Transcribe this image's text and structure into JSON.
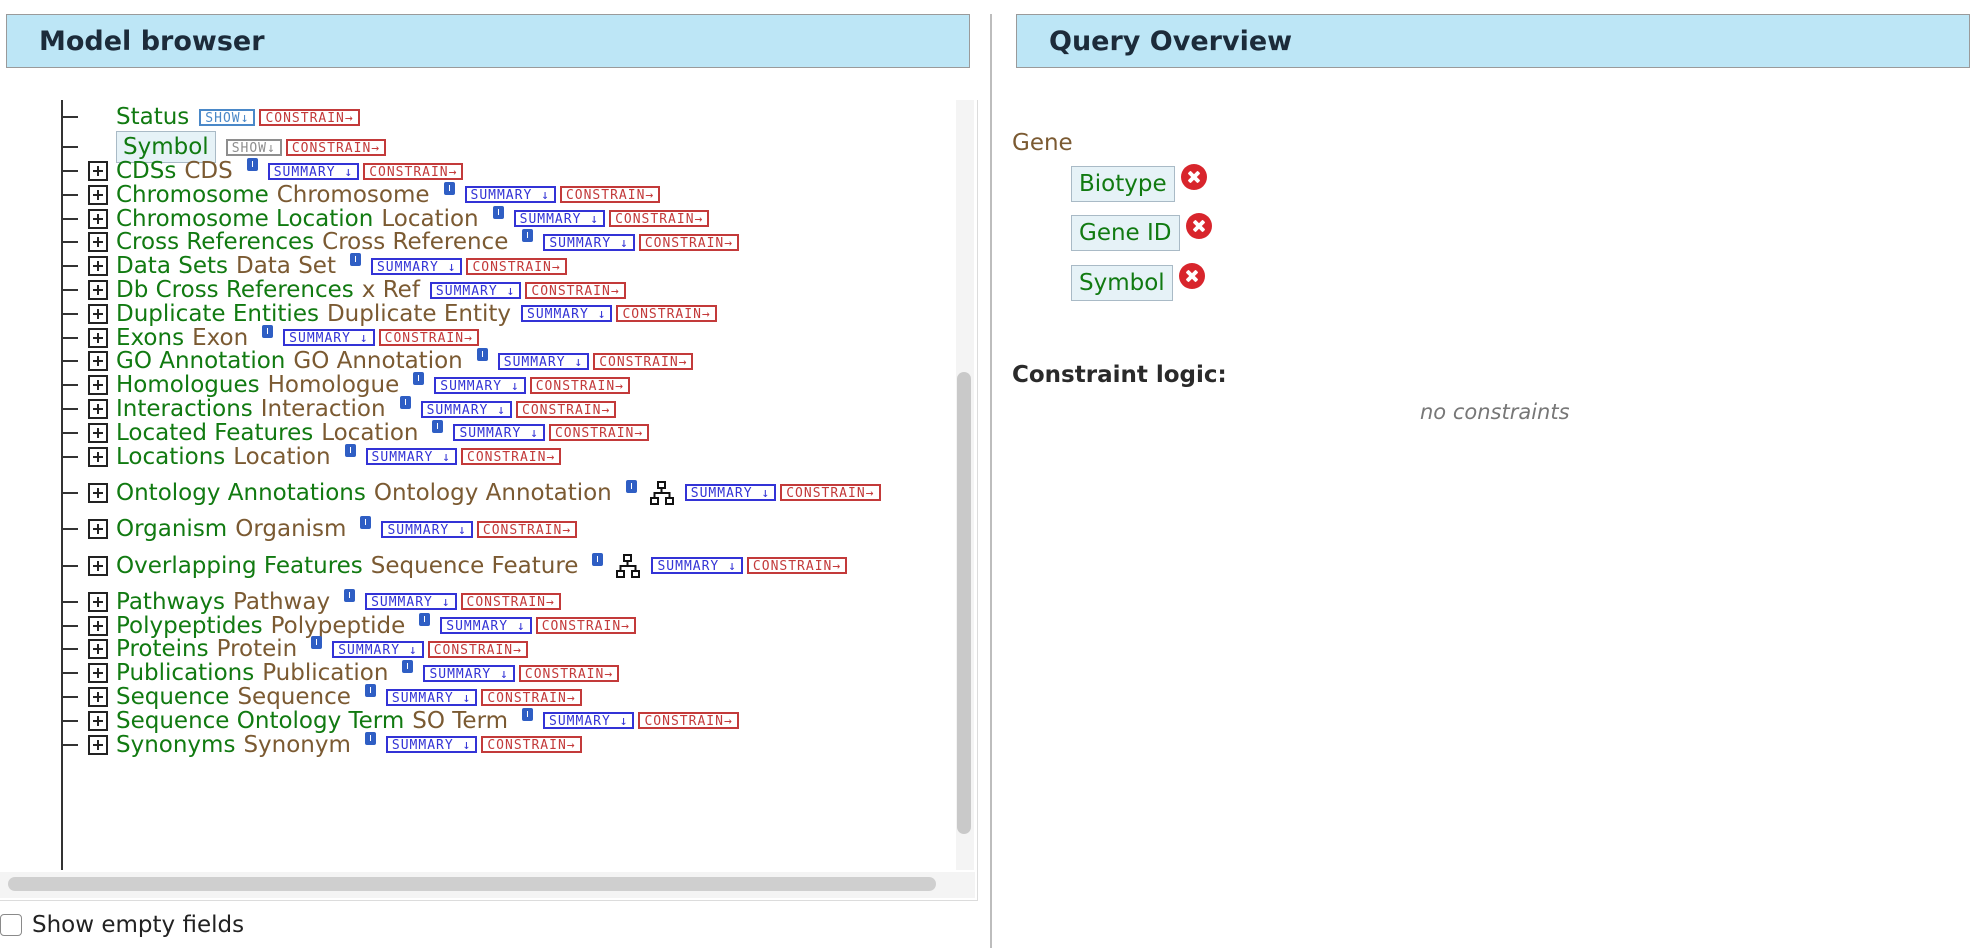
{
  "model_browser": {
    "title": "Model browser",
    "attributes": [
      {
        "name": "Status",
        "show": "SHOW",
        "constrain": "CONSTRAIN",
        "boxed": false,
        "show_grey": false
      },
      {
        "name": "Symbol",
        "show": "SHOW",
        "constrain": "CONSTRAIN",
        "boxed": true,
        "show_grey": true
      }
    ],
    "references": [
      {
        "name": "CDSs",
        "type": "CDS",
        "summary": "SUMMARY",
        "constrain": "CONSTRAIN",
        "graph": false
      },
      {
        "name": "Chromosome",
        "type": "Chromosome",
        "summary": "SUMMARY",
        "constrain": "CONSTRAIN",
        "graph": false
      },
      {
        "name": "Chromosome Location",
        "type": "Location",
        "summary": "SUMMARY",
        "constrain": "CONSTRAIN",
        "graph": false
      },
      {
        "name": "Cross References",
        "type": "Cross Reference",
        "summary": "SUMMARY",
        "constrain": "CONSTRAIN",
        "graph": false
      },
      {
        "name": "Data Sets",
        "type": "Data Set",
        "summary": "SUMMARY",
        "constrain": "CONSTRAIN",
        "graph": false
      },
      {
        "name": "Db Cross References",
        "type": "x Ref",
        "summary": "SUMMARY",
        "constrain": "CONSTRAIN",
        "graph": false,
        "no_info": true
      },
      {
        "name": "Duplicate Entities",
        "type": "Duplicate Entity",
        "summary": "SUMMARY",
        "constrain": "CONSTRAIN",
        "graph": false,
        "no_info": true
      },
      {
        "name": "Exons",
        "type": "Exon",
        "summary": "SUMMARY",
        "constrain": "CONSTRAIN",
        "graph": false
      },
      {
        "name": "GO Annotation",
        "type": "GO Annotation",
        "summary": "SUMMARY",
        "constrain": "CONSTRAIN",
        "graph": false
      },
      {
        "name": "Homologues",
        "type": "Homologue",
        "summary": "SUMMARY",
        "constrain": "CONSTRAIN",
        "graph": false
      },
      {
        "name": "Interactions",
        "type": "Interaction",
        "summary": "SUMMARY",
        "constrain": "CONSTRAIN",
        "graph": false
      },
      {
        "name": "Located Features",
        "type": "Location",
        "summary": "SUMMARY",
        "constrain": "CONSTRAIN",
        "graph": false
      },
      {
        "name": "Locations",
        "type": "Location",
        "summary": "SUMMARY",
        "constrain": "CONSTRAIN",
        "graph": false
      },
      {
        "name": "Ontology Annotations",
        "type": "Ontology Annotation",
        "summary": "SUMMARY",
        "constrain": "CONSTRAIN",
        "graph": true
      },
      {
        "name": "Organism",
        "type": "Organism",
        "summary": "SUMMARY",
        "constrain": "CONSTRAIN",
        "graph": false
      },
      {
        "name": "Overlapping Features",
        "type": "Sequence Feature",
        "summary": "SUMMARY",
        "constrain": "CONSTRAIN",
        "graph": true
      },
      {
        "name": "Pathways",
        "type": "Pathway",
        "summary": "SUMMARY",
        "constrain": "CONSTRAIN",
        "graph": false
      },
      {
        "name": "Polypeptides",
        "type": "Polypeptide",
        "summary": "SUMMARY",
        "constrain": "CONSTRAIN",
        "graph": false
      },
      {
        "name": "Proteins",
        "type": "Protein",
        "summary": "SUMMARY",
        "constrain": "CONSTRAIN",
        "graph": false
      },
      {
        "name": "Publications",
        "type": "Publication",
        "summary": "SUMMARY",
        "constrain": "CONSTRAIN",
        "graph": false
      },
      {
        "name": "Sequence",
        "type": "Sequence",
        "summary": "SUMMARY",
        "constrain": "CONSTRAIN",
        "graph": false
      },
      {
        "name": "Sequence Ontology Term",
        "type": "SO Term",
        "summary": "SUMMARY",
        "constrain": "CONSTRAIN",
        "graph": false
      },
      {
        "name": "Synonyms",
        "type": "Synonym",
        "summary": "SUMMARY",
        "constrain": "CONSTRAIN",
        "graph": false
      }
    ],
    "show_empty_label": "Show empty fields"
  },
  "query_overview": {
    "title": "Query Overview",
    "root_class": "Gene",
    "selected_fields": [
      "Biotype",
      "Gene ID",
      "Symbol"
    ],
    "constraint_logic_label": "Constraint logic:",
    "no_constraints_text": "no constraints"
  },
  "icons": {
    "info": "info-icon",
    "expand": "plus-box-icon",
    "graph": "hierarchy-icon",
    "remove": "remove-circle-icon"
  },
  "colors": {
    "header_bg": "#bde6f6",
    "field_green": "#117a11",
    "type_brown": "#7b5a32",
    "summary_blue": "#3333d6",
    "constrain_red": "#c33a3a",
    "remove_red": "#d8252c"
  }
}
